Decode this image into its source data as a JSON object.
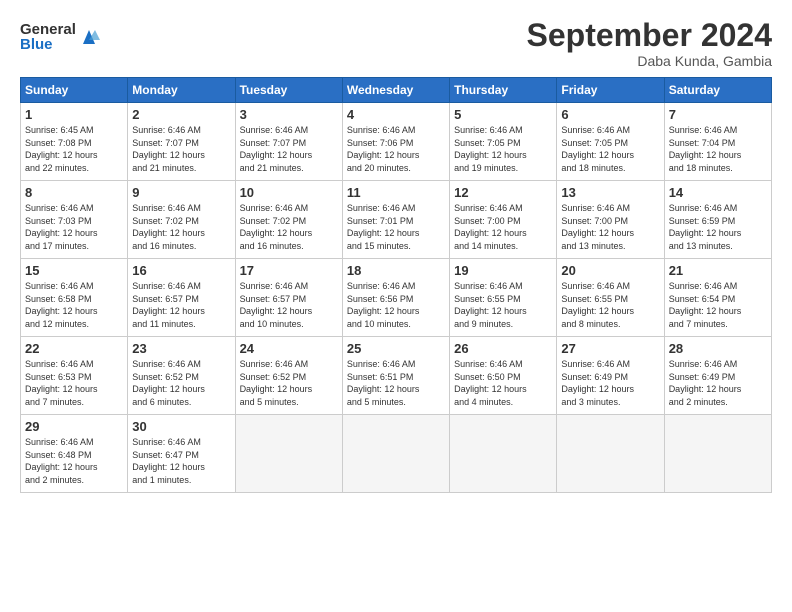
{
  "header": {
    "logo_general": "General",
    "logo_blue": "Blue",
    "month_title": "September 2024",
    "location": "Daba Kunda, Gambia"
  },
  "weekdays": [
    "Sunday",
    "Monday",
    "Tuesday",
    "Wednesday",
    "Thursday",
    "Friday",
    "Saturday"
  ],
  "weeks": [
    [
      {
        "day": "1",
        "rise": "6:45 AM",
        "set": "7:08 PM",
        "hours": "12",
        "mins": "22"
      },
      {
        "day": "2",
        "rise": "6:46 AM",
        "set": "7:07 PM",
        "hours": "12",
        "mins": "21"
      },
      {
        "day": "3",
        "rise": "6:46 AM",
        "set": "7:07 PM",
        "hours": "12",
        "mins": "21"
      },
      {
        "day": "4",
        "rise": "6:46 AM",
        "set": "7:06 PM",
        "hours": "12",
        "mins": "20"
      },
      {
        "day": "5",
        "rise": "6:46 AM",
        "set": "7:05 PM",
        "hours": "12",
        "mins": "19"
      },
      {
        "day": "6",
        "rise": "6:46 AM",
        "set": "7:05 PM",
        "hours": "12",
        "mins": "18"
      },
      {
        "day": "7",
        "rise": "6:46 AM",
        "set": "7:04 PM",
        "hours": "12",
        "mins": "18"
      }
    ],
    [
      {
        "day": "8",
        "rise": "6:46 AM",
        "set": "7:03 PM",
        "hours": "12",
        "mins": "17"
      },
      {
        "day": "9",
        "rise": "6:46 AM",
        "set": "7:02 PM",
        "hours": "12",
        "mins": "16"
      },
      {
        "day": "10",
        "rise": "6:46 AM",
        "set": "7:02 PM",
        "hours": "12",
        "mins": "16"
      },
      {
        "day": "11",
        "rise": "6:46 AM",
        "set": "7:01 PM",
        "hours": "12",
        "mins": "15"
      },
      {
        "day": "12",
        "rise": "6:46 AM",
        "set": "7:00 PM",
        "hours": "12",
        "mins": "14"
      },
      {
        "day": "13",
        "rise": "6:46 AM",
        "set": "7:00 PM",
        "hours": "12",
        "mins": "13"
      },
      {
        "day": "14",
        "rise": "6:46 AM",
        "set": "6:59 PM",
        "hours": "12",
        "mins": "13"
      }
    ],
    [
      {
        "day": "15",
        "rise": "6:46 AM",
        "set": "6:58 PM",
        "hours": "12",
        "mins": "12"
      },
      {
        "day": "16",
        "rise": "6:46 AM",
        "set": "6:57 PM",
        "hours": "12",
        "mins": "11"
      },
      {
        "day": "17",
        "rise": "6:46 AM",
        "set": "6:57 PM",
        "hours": "12",
        "mins": "10"
      },
      {
        "day": "18",
        "rise": "6:46 AM",
        "set": "6:56 PM",
        "hours": "12",
        "mins": "10"
      },
      {
        "day": "19",
        "rise": "6:46 AM",
        "set": "6:55 PM",
        "hours": "12",
        "mins": "9"
      },
      {
        "day": "20",
        "rise": "6:46 AM",
        "set": "6:55 PM",
        "hours": "12",
        "mins": "8"
      },
      {
        "day": "21",
        "rise": "6:46 AM",
        "set": "6:54 PM",
        "hours": "12",
        "mins": "7"
      }
    ],
    [
      {
        "day": "22",
        "rise": "6:46 AM",
        "set": "6:53 PM",
        "hours": "12",
        "mins": "7"
      },
      {
        "day": "23",
        "rise": "6:46 AM",
        "set": "6:52 PM",
        "hours": "12",
        "mins": "6"
      },
      {
        "day": "24",
        "rise": "6:46 AM",
        "set": "6:52 PM",
        "hours": "12",
        "mins": "5"
      },
      {
        "day": "25",
        "rise": "6:46 AM",
        "set": "6:51 PM",
        "hours": "12",
        "mins": "5"
      },
      {
        "day": "26",
        "rise": "6:46 AM",
        "set": "6:50 PM",
        "hours": "12",
        "mins": "4"
      },
      {
        "day": "27",
        "rise": "6:46 AM",
        "set": "6:49 PM",
        "hours": "12",
        "mins": "3"
      },
      {
        "day": "28",
        "rise": "6:46 AM",
        "set": "6:49 PM",
        "hours": "12",
        "mins": "2"
      }
    ],
    [
      {
        "day": "29",
        "rise": "6:46 AM",
        "set": "6:48 PM",
        "hours": "12",
        "mins": "2"
      },
      {
        "day": "30",
        "rise": "6:46 AM",
        "set": "6:47 PM",
        "hours": "12",
        "mins": "1"
      },
      null,
      null,
      null,
      null,
      null
    ]
  ]
}
